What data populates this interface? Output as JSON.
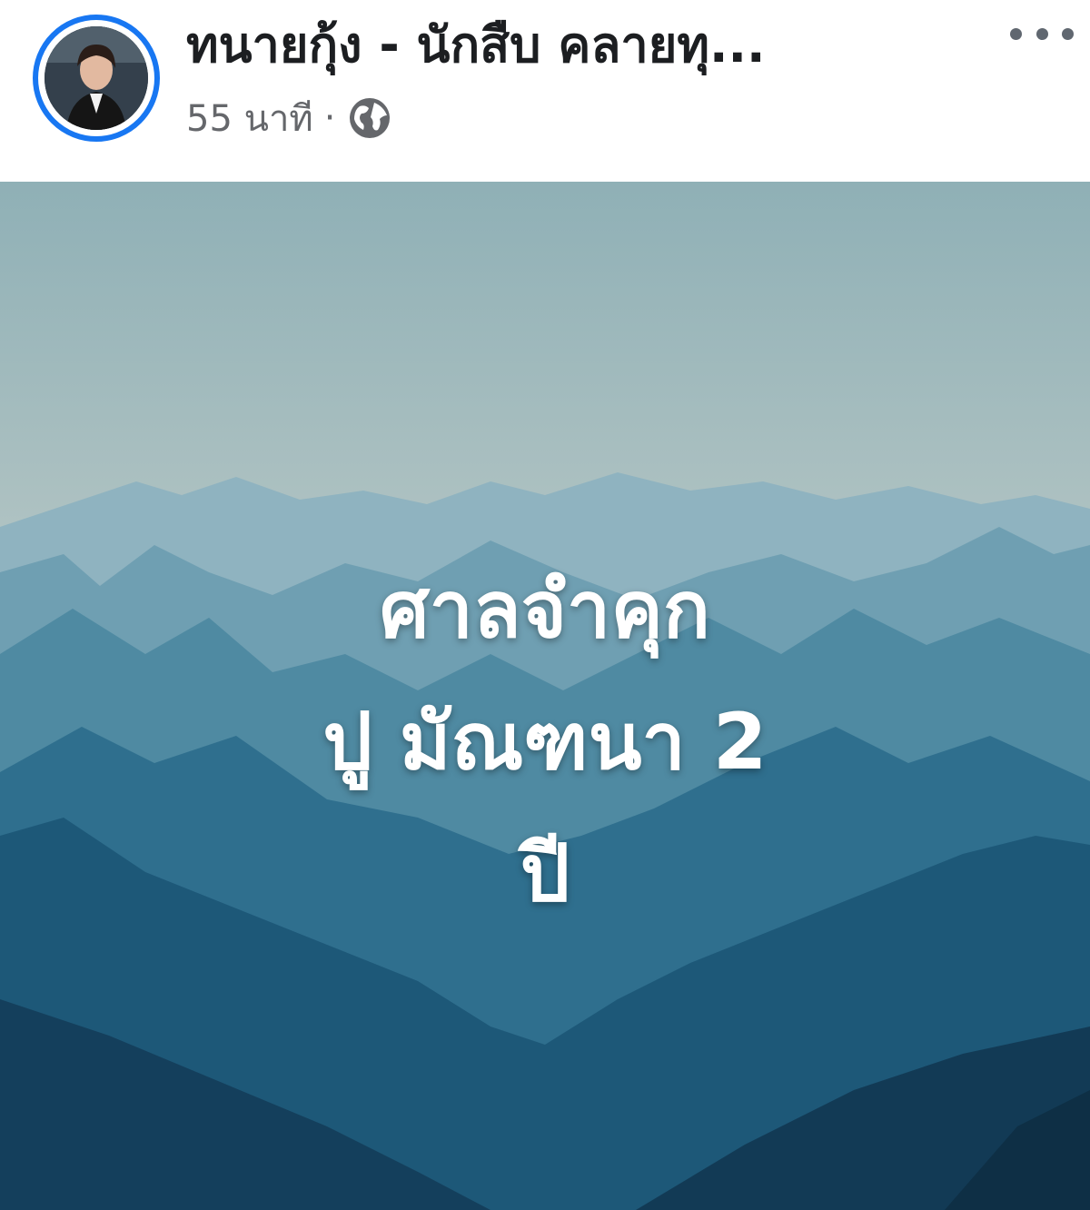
{
  "post": {
    "author_name": "ทนายกุ้ง - นักสืบ คลายทุ...",
    "timestamp": "55 นาที",
    "separator": "·",
    "privacy_icon": "globe-icon",
    "more_icon": "more-options-icon"
  },
  "image": {
    "overlay_lines": [
      "ศาลจำคุก",
      "ปู มัณฑนา 2",
      "ปี"
    ]
  },
  "colors": {
    "avatar_ring": "#1877f2",
    "sky_top": "#8fb0b6",
    "sky_mid": "#c9d3cf",
    "mountain_dark": "#123a55"
  }
}
